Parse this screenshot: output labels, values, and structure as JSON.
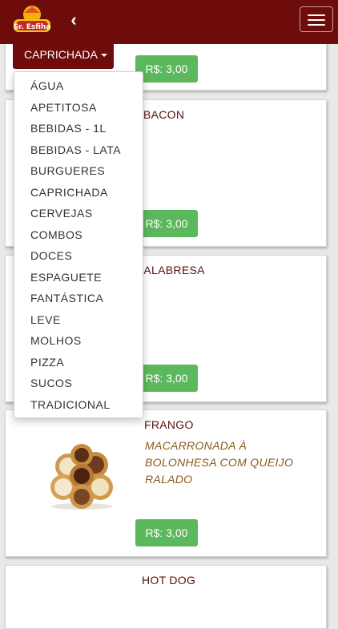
{
  "header": {
    "logo_text": "Sr. Esfiha",
    "back_icon": "chevron-left-icon",
    "menu_icon": "hamburger-menu-icon",
    "bar_color": "#6e0b0b"
  },
  "category_select": {
    "selected": "CAPRICHADA",
    "options": [
      "ÁGUA",
      "APETITOSA",
      "BEBIDAS - 1L",
      "BEBIDAS - LATA",
      "BURGUERES",
      "CAPRICHADA",
      "CERVEJAS",
      "COMBOS",
      "DOCES",
      "ESPAGUETE",
      "FANTÁSTICA",
      "LEVE",
      "MOLHOS",
      "PIZZA",
      "SUCOS",
      "TRADICIONAL"
    ]
  },
  "products": [
    {
      "title": "",
      "description": "",
      "price": "R$: 3,00"
    },
    {
      "title": "BACON",
      "description": "",
      "price": "R$: 3,00"
    },
    {
      "title": "CALABRESA",
      "description": "",
      "price": "R$: 3,00"
    },
    {
      "title": "FRANGO",
      "description": "MACARRONADA À BOLONHESA COM QUEIJO RALADO",
      "price": "R$: 3,00"
    },
    {
      "title": "HOT DOG",
      "description": "",
      "price": ""
    }
  ],
  "colors": {
    "accent": "#6e0b0b",
    "price_button": "#5cb85c",
    "description_text": "#8a5a1a"
  }
}
